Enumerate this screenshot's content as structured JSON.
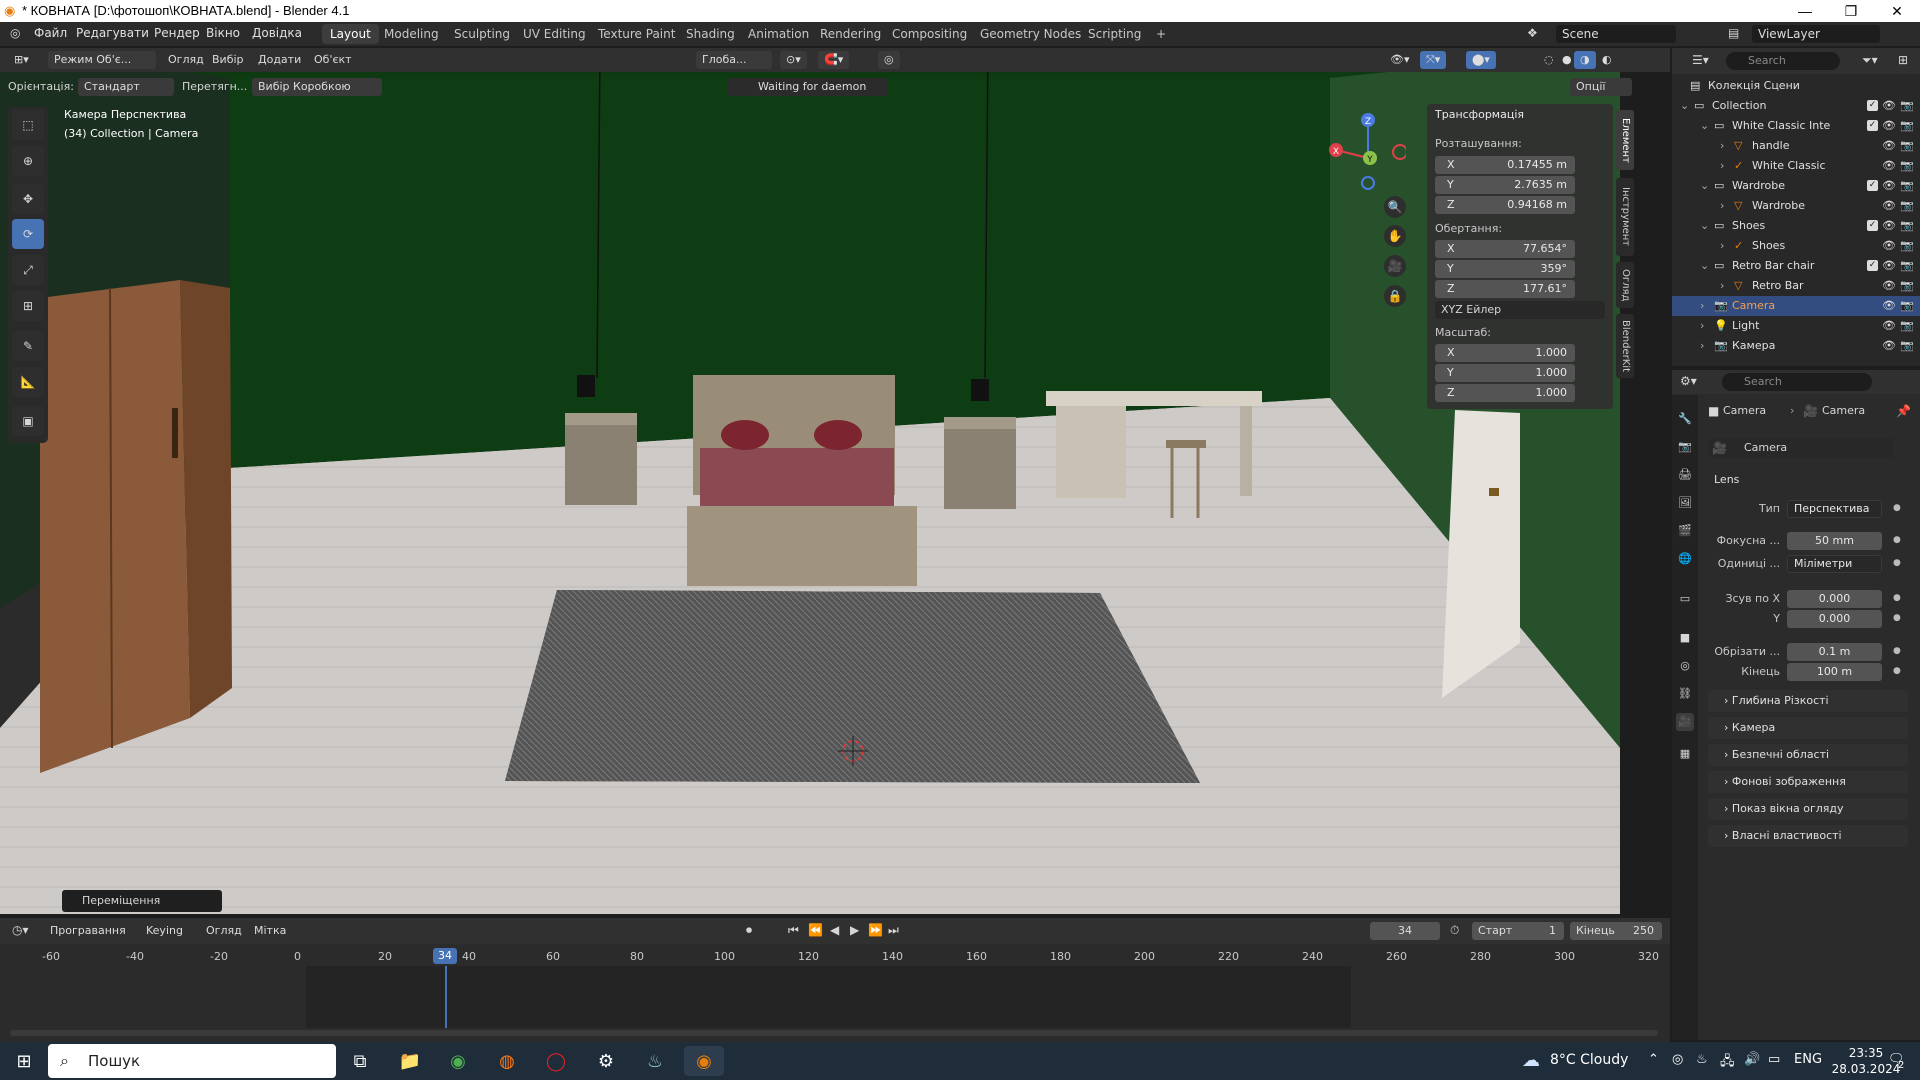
{
  "window": {
    "title": "* КОВНАТА [D:\\фотошоп\\КОВНАТА.blend] - Blender 4.1",
    "controls": {
      "minimize": "—",
      "maximize": "❐",
      "close": "✕"
    }
  },
  "menu": [
    "Файл",
    "Редагувати",
    "Рендер",
    "Вікно",
    "Довідка"
  ],
  "workspaces": [
    "Layout",
    "Modeling",
    "Sculpting",
    "UV Editing",
    "Texture Paint",
    "Shading",
    "Animation",
    "Rendering",
    "Compositing",
    "Geometry Nodes",
    "Scripting"
  ],
  "workspace_add": "+",
  "scene": "Scene",
  "view_layer": "ViewLayer",
  "viewport": {
    "mode": "Режим Об'є...",
    "menus": [
      "Огляд",
      "Вибір",
      "Додати",
      "Об'єкт"
    ],
    "transform_orientation": "Глоба...",
    "orientation_label": "Орієнтація:",
    "orientation_value": "Стандарт",
    "drag_label": "Перетягн...",
    "drag_value": "Вибір Коробкою",
    "daemon_status": "Waiting for daemon",
    "options_btn": "Опції",
    "camera_label": "Камера Перспектива",
    "camera_sub": "(34) Collection | Camera",
    "last_op": "Переміщення",
    "gizmo": {
      "x": "X",
      "y": "Y",
      "z": "Z"
    }
  },
  "npanel": {
    "header": "Трансформація",
    "location_label": "Розташування:",
    "location": [
      {
        "axis": "X",
        "value": "0.17455 m"
      },
      {
        "axis": "Y",
        "value": "2.7635 m"
      },
      {
        "axis": "Z",
        "value": "0.94168 m"
      }
    ],
    "rotation_label": "Обертання:",
    "rotation": [
      {
        "axis": "X",
        "value": "77.654°"
      },
      {
        "axis": "Y",
        "value": "359°"
      },
      {
        "axis": "Z",
        "value": "177.61°"
      }
    ],
    "rotation_mode": "XYZ Ейлер",
    "scale_label": "Масштаб:",
    "scale": [
      {
        "axis": "X",
        "value": "1.000"
      },
      {
        "axis": "Y",
        "value": "1.000"
      },
      {
        "axis": "Z",
        "value": "1.000"
      }
    ],
    "tabs": [
      "Елемент",
      "Інструмент",
      "Огляд",
      "BlenderKit"
    ]
  },
  "outliner": {
    "search_placeholder": "Search",
    "root": "Колекція Сцени",
    "rows": [
      {
        "label": "Collection",
        "indent": 1,
        "type": "collection"
      },
      {
        "label": "White Classic Inte",
        "indent": 2,
        "type": "collection"
      },
      {
        "label": "handle",
        "indent": 3,
        "type": "mesh"
      },
      {
        "label": "White Classic",
        "indent": 3,
        "type": "armature"
      },
      {
        "label": "Wardrobe",
        "indent": 2,
        "type": "collection"
      },
      {
        "label": "Wardrobe",
        "indent": 3,
        "type": "mesh"
      },
      {
        "label": "Shoes",
        "indent": 2,
        "type": "collection"
      },
      {
        "label": "Shoes",
        "indent": 3,
        "type": "armature"
      },
      {
        "label": "Retro Bar chair",
        "indent": 2,
        "type": "collection"
      },
      {
        "label": "Retro Bar",
        "indent": 3,
        "type": "mesh"
      },
      {
        "label": "Camera",
        "indent": 2,
        "type": "camera",
        "selected": true
      },
      {
        "label": "Light",
        "indent": 2,
        "type": "light"
      },
      {
        "label": "Камера",
        "indent": 2,
        "type": "camera"
      }
    ]
  },
  "properties": {
    "search_placeholder": "Search",
    "breadcrumb": [
      "Camera",
      "Camera"
    ],
    "datablock": "Camera",
    "lens_header": "Lens",
    "fields": [
      {
        "label": "Тип",
        "value": "Перспектива",
        "kind": "drop"
      },
      {
        "label": "Фокусна ...",
        "value": "50 mm",
        "kind": "field"
      },
      {
        "label": "Одиниці ...",
        "value": "Міліметри",
        "kind": "drop"
      },
      {
        "label": "Зсув по X",
        "value": "0.000",
        "kind": "field"
      },
      {
        "label": "Y",
        "value": "0.000",
        "kind": "field"
      },
      {
        "label": "Обрізати ...",
        "value": "0.1 m",
        "kind": "field"
      },
      {
        "label": "Кінець",
        "value": "100 m",
        "kind": "field"
      }
    ],
    "sections": [
      "Глибина Різкості",
      "Камера",
      "Безпечні області",
      "Фонові зображення",
      "Показ вікна огляду",
      "Власні властивості"
    ]
  },
  "timeline": {
    "menus": [
      "Програвання",
      "Keying",
      "Огляд",
      "Мітка"
    ],
    "current_frame": "34",
    "start_label": "Старт",
    "start": "1",
    "end_label": "Кінець",
    "end": "250",
    "ticks": [
      "-60",
      "-40",
      "-20",
      "0",
      "20",
      "40",
      "60",
      "80",
      "100",
      "120",
      "140",
      "160",
      "180",
      "200",
      "220",
      "240",
      "260",
      "280",
      "300",
      "320"
    ]
  },
  "taskbar": {
    "search": "Пошук",
    "weather": "8°C  Cloudy",
    "lang": "ENG",
    "time": "23:35",
    "date": "28.03.2024",
    "notif": "2"
  }
}
